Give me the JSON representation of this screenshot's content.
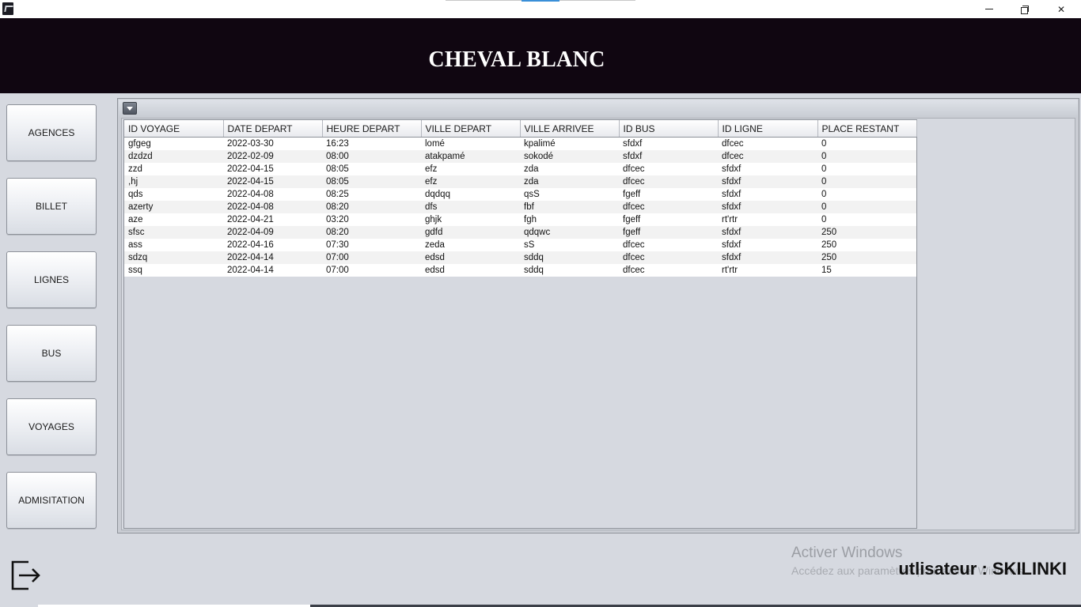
{
  "window": {
    "title": "",
    "controls": {
      "minimize": "minimize-icon",
      "maximize": "restore-icon",
      "close": "close-icon"
    }
  },
  "header": {
    "brand": "CHEVAL BLANC",
    "background": "#100611"
  },
  "sidebar": {
    "items": [
      {
        "label": "AGENCES"
      },
      {
        "label": "BILLET"
      },
      {
        "label": "LIGNES"
      },
      {
        "label": "BUS"
      },
      {
        "label": "VOYAGES"
      },
      {
        "label": "ADMISITATION"
      }
    ]
  },
  "table": {
    "columns": [
      "ID VOYAGE",
      "DATE DEPART",
      "HEURE DEPART",
      "VILLE DEPART",
      "VILLE ARRIVEE",
      "ID BUS",
      "ID LIGNE",
      "PLACE RESTANT"
    ],
    "rows": [
      [
        "gfgeg",
        "2022-03-30",
        "16:23",
        "lomé",
        "kpalimé",
        "sfdxf",
        "dfcec",
        "0"
      ],
      [
        "dzdzd",
        "2022-02-09",
        "08:00",
        "atakpamé",
        "sokodé",
        "sfdxf",
        "dfcec",
        "0"
      ],
      [
        "zzd",
        "2022-04-15",
        "08:05",
        "efz",
        "zda",
        "dfcec",
        "sfdxf",
        "0"
      ],
      [
        ",hj",
        "2022-04-15",
        "08:05",
        "efz",
        "zda",
        "dfcec",
        "sfdxf",
        "0"
      ],
      [
        "qds",
        "2022-04-08",
        "08:25",
        "dqdqq",
        "qsS",
        "fgeff",
        "sfdxf",
        "0"
      ],
      [
        "azerty",
        "2022-04-08",
        "08:20",
        "dfs",
        "fbf",
        "dfcec",
        "sfdxf",
        "0"
      ],
      [
        "aze",
        "2022-04-21",
        "03:20",
        "ghjk",
        "fgh",
        "fgeff",
        "rt'rtr",
        "0"
      ],
      [
        "sfsc",
        "2022-04-09",
        "08:20",
        "gdfd",
        "qdqwc",
        "fgeff",
        "sfdxf",
        "250"
      ],
      [
        "ass",
        "2022-04-16",
        "07:30",
        "zeda",
        "sS",
        "dfcec",
        "sfdxf",
        "250"
      ],
      [
        "sdzq",
        "2022-04-14",
        "07:00",
        "edsd",
        "sddq",
        "dfcec",
        "sfdxf",
        "250"
      ],
      [
        "ssq",
        "2022-04-14",
        "07:00",
        "edsd",
        "sddq",
        "dfcec",
        "rt'rtr",
        "15"
      ]
    ]
  },
  "footer": {
    "logout_icon": "logout-icon",
    "user_label": "utlisateur : SKILINKI",
    "watermark_title": "Activer Windows",
    "watermark_sub": "Accédez aux paramètres pour activer Windows."
  }
}
